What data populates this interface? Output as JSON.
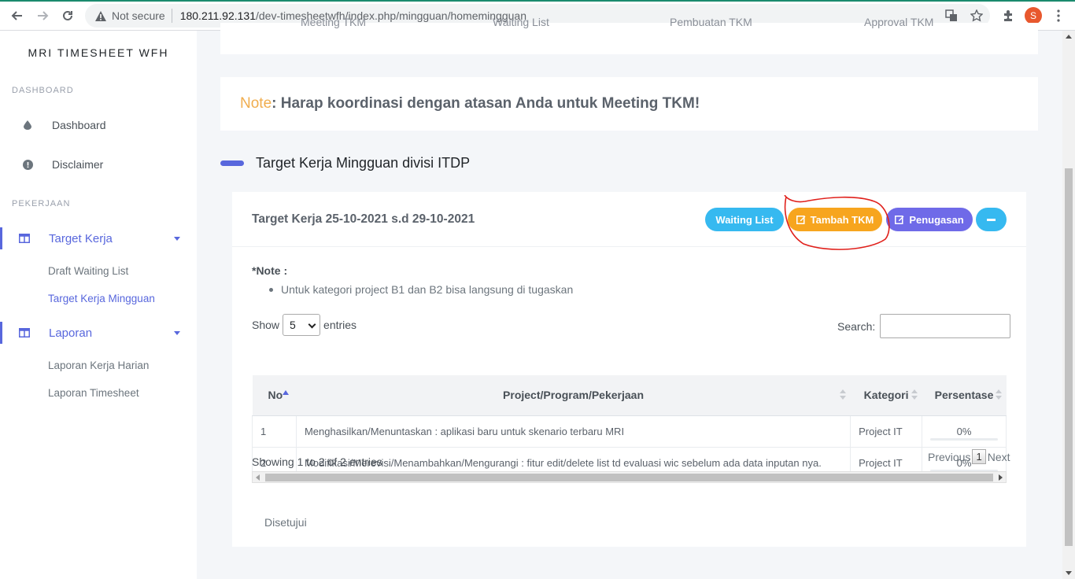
{
  "browser": {
    "security_text": "Not secure",
    "url_host": "180.211.92.131",
    "url_path": "/dev-timesheetwfh/index.php/mingguan/homemingguan",
    "profile_initial": "S"
  },
  "sidebar": {
    "brand": "MRI TIMESHEET WFH",
    "section_dashboard": "DASHBOARD",
    "dashboard": "Dashboard",
    "disclaimer": "Disclaimer",
    "section_pekerjaan": "PEKERJAAN",
    "target_kerja": "Target Kerja",
    "draft_waiting_list": "Draft Waiting List",
    "target_kerja_mingguan": "Target Kerja Mingguan",
    "laporan": "Laporan",
    "laporan_kerja_harian": "Laporan Kerja Harian",
    "laporan_timesheet": "Laporan Timesheet"
  },
  "top_tabs": [
    "Meeting TKM",
    "Waiting List",
    "Pembuatan TKM",
    "Approval TKM"
  ],
  "note": {
    "label": "Note",
    "text": " : Harap koordinasi dengan atasan Anda untuk Meeting TKM!"
  },
  "section_title": "Target Kerja Mingguan divisi ITDP",
  "panel": {
    "title": "Target Kerja 25-10-2021 s.d 29-10-2021",
    "btn_waiting": "Waiting List",
    "btn_tambah": "Tambah TKM",
    "btn_penugasan": "Penugasan",
    "note_title": "*Note :",
    "note_item": "Untuk kategori project B1 dan B2 bisa langsung di tugaskan",
    "show_label": "Show",
    "show_value": "5",
    "entries_label": "entries",
    "search_label": "Search:",
    "columns": [
      "No",
      "Project/Program/Pekerjaan",
      "Kategori",
      "Persentase"
    ],
    "rows": [
      {
        "no": "1",
        "project": "Menghasilkan/Menuntaskan : aplikasi baru untuk skenario terbaru MRI",
        "kategori": "Project IT",
        "persentase": "0%"
      },
      {
        "no": "2",
        "project": "Modifikasi/Merevisi/Menambahkan/Mengurangi : fitur edit/delete list td evaluasi wic sebelum ada data inputan nya.",
        "kategori": "Project IT",
        "persentase": "0%"
      }
    ],
    "info": "Showing 1 to 2 of 2 entries",
    "prev": "Previous",
    "page": "1",
    "next": "Next",
    "approved_tab": "Disetujui"
  },
  "colors": {
    "accent": "#5867dd",
    "warning": "#f7a51e",
    "info": "#36b9f0",
    "purple": "#6f6ae8",
    "annotation": "#e0201b"
  }
}
